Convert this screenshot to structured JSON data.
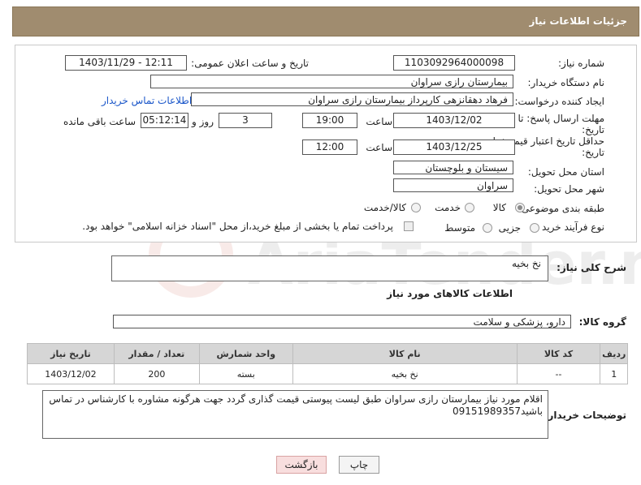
{
  "header": {
    "title": "جزئیات اطلاعات نیاز"
  },
  "form": {
    "need_number_label": "شماره نیاز:",
    "need_number": "1103092964000098",
    "announce_label": "تاریخ و ساعت اعلان عمومی:",
    "announce_value": "1403/11/29 - 12:11",
    "buyer_org_label": "نام دستگاه خریدار:",
    "buyer_org": "بیمارستان رازی سراوان",
    "creator_label": "ایجاد کننده درخواست:",
    "creator": "فرهاد دهقانزهی کارپرداز بیمارستان رازی سراوان",
    "contact_link": "اطلاعات تماس خریدار",
    "deadline_label_1": "مهلت ارسال پاسخ: تا",
    "deadline_label_2": "تاریخ:",
    "deadline_date": "1403/12/02",
    "time_label": "ساعت",
    "deadline_time": "19:00",
    "days_value": "3",
    "days_label": "روز و",
    "remaining_time": "05:12:14",
    "remaining_label": "ساعت باقی مانده",
    "validity_label_1": "حداقل تاریخ اعتبار قیمت: تا",
    "validity_label_2": "تاریخ:",
    "validity_date": "1403/12/25",
    "validity_time_label": "ساعت",
    "validity_time": "12:00",
    "province_label": "استان محل تحویل:",
    "province": "سیستان و بلوچستان",
    "city_label": "شهر محل تحویل:",
    "city": "سراوان",
    "category_label": "طبقه بندی موضوعی:",
    "category_options": [
      "کالا",
      "خدمت",
      "کالا/خدمت"
    ],
    "category_selected": "کالا",
    "process_label": "نوع فرآیند خرید :",
    "process_options": [
      "جزیی",
      "متوسط"
    ],
    "payment_note": "پرداخت تمام یا بخشی از مبلغ خرید،از محل \"اسناد خزانه اسلامی\" خواهد بود."
  },
  "summary": {
    "label": "شرح کلی نیاز:",
    "value": "نخ بخیه"
  },
  "goods_section": {
    "title": "اطلاعات کالاهای مورد نیاز",
    "group_label": "گروه کالا:",
    "group_value": "دارو، پزشکی و سلامت"
  },
  "table": {
    "headers": [
      "ردیف",
      "کد کالا",
      "نام کالا",
      "واحد شمارش",
      "تعداد / مقدار",
      "تاریخ نیاز"
    ],
    "rows": [
      [
        "1",
        "--",
        "نخ بخیه",
        "بسته",
        "200",
        "1403/12/02"
      ]
    ]
  },
  "buyer_notes": {
    "label": "توضیحات خریدار:",
    "value": "اقلام مورد نیاز بیمارستان رازی سراوان طبق لیست پیوستی قیمت گذاری گردد جهت هرگونه مشاوره با کارشناس در تماس باشید09151989357"
  },
  "buttons": {
    "print": "چاپ",
    "back": "بازگشت"
  },
  "watermark_text": "AriaTender.net",
  "colors": {
    "header_bg": "#a08c6f",
    "link": "#1a56c9",
    "back_button_bg": "#f8dede"
  }
}
